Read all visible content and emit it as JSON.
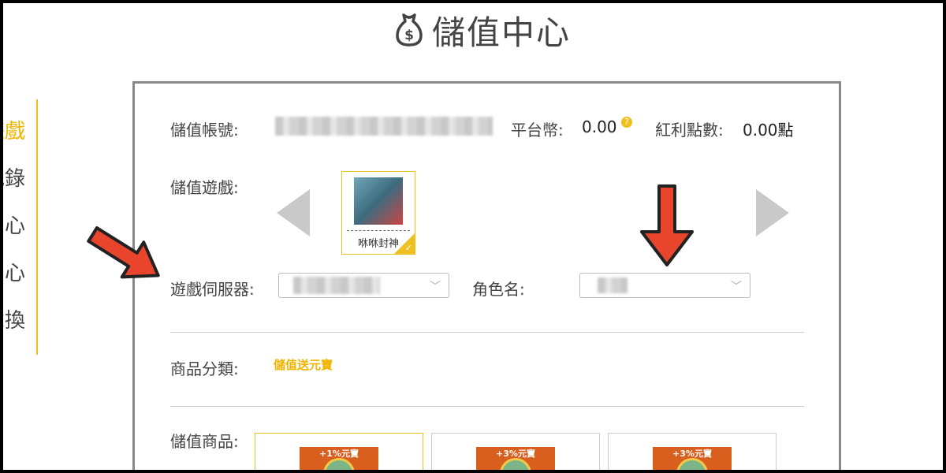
{
  "header": {
    "icon": "money-bag-icon",
    "title": "儲值中心"
  },
  "sidebar": {
    "items": [
      {
        "label": "遊戲",
        "active": true
      },
      {
        "label": "紀錄",
        "active": false
      },
      {
        "label": "中心",
        "active": false
      },
      {
        "label": "中心",
        "active": false
      },
      {
        "label": "兌換",
        "active": false
      }
    ]
  },
  "account": {
    "label": "儲值帳號:",
    "platform_label": "平台幣:",
    "platform_value": "0.00",
    "bonus_label": "紅利點數:",
    "bonus_value": "0.00點"
  },
  "game": {
    "label": "儲值遊戲:",
    "selected_name": "咻咻封神",
    "prev_icon": "chevron-left-icon",
    "next_icon": "chevron-right-icon"
  },
  "server": {
    "label": "遊戲伺服器:",
    "role_label": "角色名:"
  },
  "category": {
    "label": "商品分類:",
    "value": "儲值送元寶"
  },
  "products": {
    "label": "儲值商品:",
    "items": [
      {
        "badge": "+1%元寶",
        "selected": true
      },
      {
        "badge": "+3%元寶",
        "selected": false
      },
      {
        "badge": "+3%元寶",
        "selected": false
      }
    ]
  },
  "colors": {
    "accent": "#f0b400",
    "arrow": "#e8452c"
  }
}
